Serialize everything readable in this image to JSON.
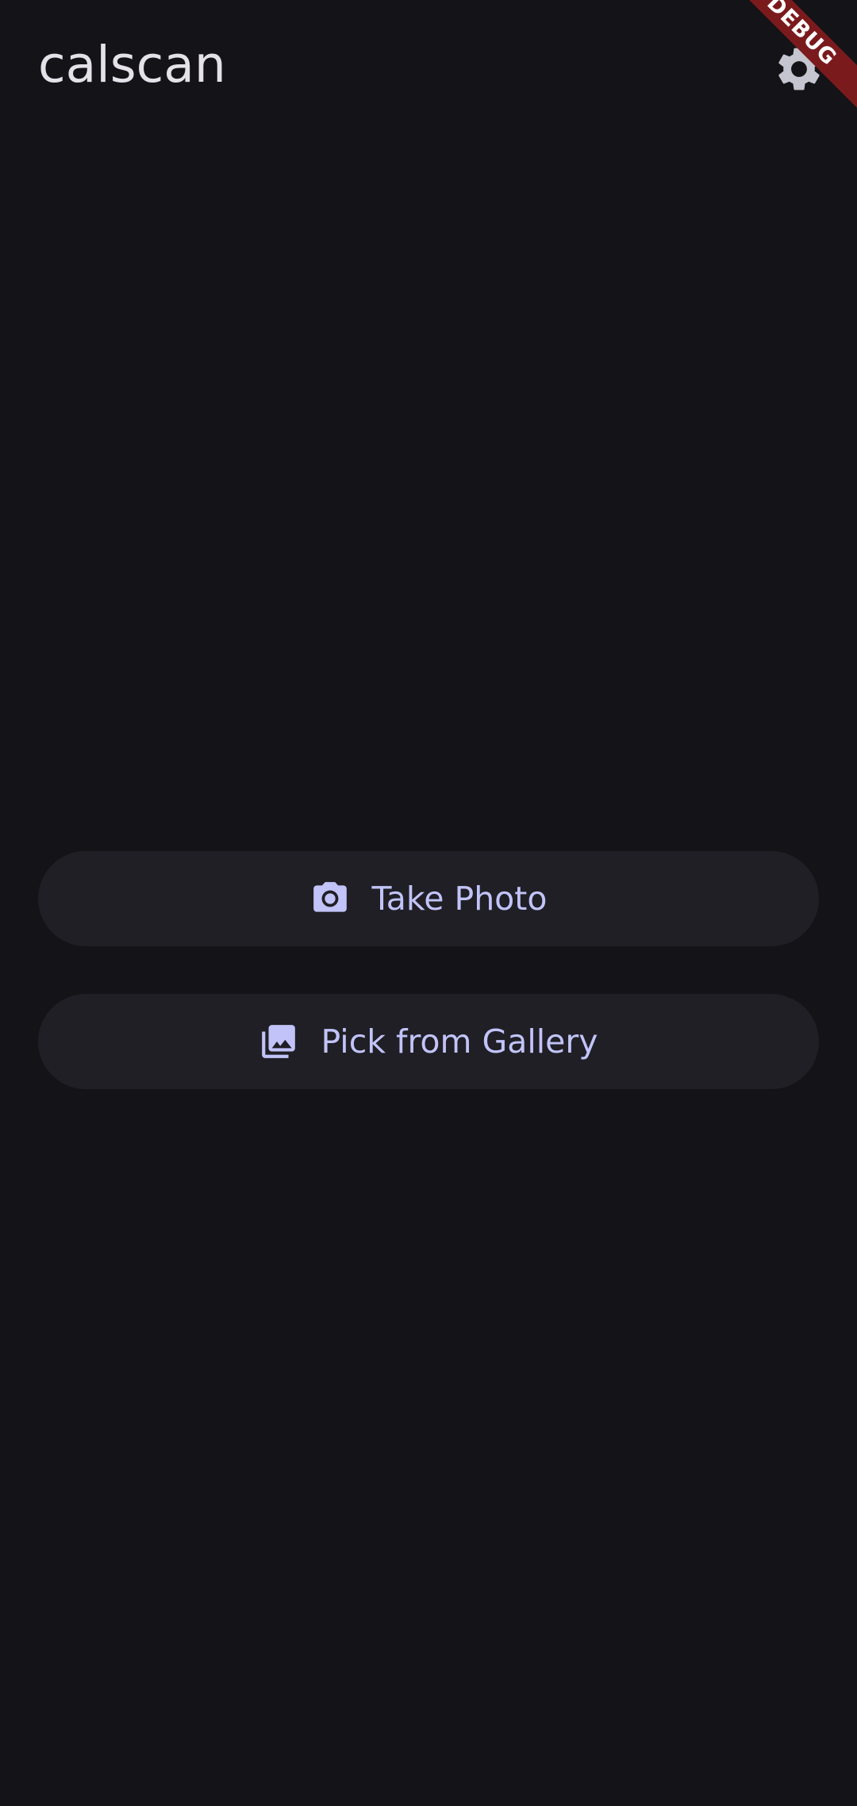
{
  "app_bar": {
    "title": "calscan",
    "settings_icon": "gear-icon"
  },
  "debug_banner": {
    "label": "DEBUG",
    "color": "#7a1a1c"
  },
  "actions": {
    "take_photo": {
      "label": "Take Photo",
      "icon": "camera-icon"
    },
    "pick_gallery": {
      "label": "Pick from Gallery",
      "icon": "photo-library-icon"
    }
  },
  "colors": {
    "background": "#131318",
    "button_surface": "#1f1f25",
    "accent": "#c2c3f8",
    "title_text": "#e4e1e9"
  }
}
